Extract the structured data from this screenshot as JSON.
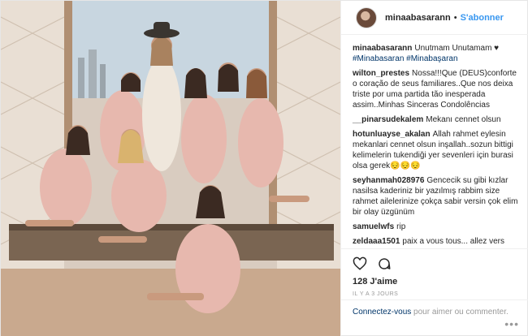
{
  "header": {
    "username": "minaabasarann",
    "separator": "•",
    "follow_label": "S'abonner"
  },
  "comments": [
    {
      "author": "minaabasarann",
      "text": "Unutmam Unutamam ♥",
      "tags": "#Minabasaran #Minabaşaran"
    },
    {
      "author": "wilton_prestes",
      "text": "Nossa!!!Que (DEUS)conforte o coração de seus familiares..Que nos deixa triste por uma partida tão inesperada assim..Minhas Sinceras Condolências"
    },
    {
      "author": "__pinarsudekalem",
      "text": "Mekanı cennet olsun"
    },
    {
      "author": "hotunluayse_akalan",
      "text": "Allah rahmet eylesin mekanlari cennet olsun inşallah..sozun bittigi kelimelerin tukendiği yer sevenleri için burasi olsa gerek😔😔😔"
    },
    {
      "author": "seyhanmah028976",
      "text": "Gencecik su gibi kızlar nasilsa kaderiniz bir yazılmış rabbim size rahmet ailelerinize çokça sabir versin çok elim bir olay üzgünüm"
    },
    {
      "author": "samuelwfs",
      "text": "rip"
    },
    {
      "author": "zeldaaa1501",
      "text": "paix a vous tous... allez vers"
    }
  ],
  "actions": {
    "likes": "128 J'aime",
    "timestamp": "IL Y A 3 JOURS"
  },
  "login": {
    "link": "Connectez-vous",
    "text": " pour aimer ou commenter."
  },
  "more_label": "•••"
}
